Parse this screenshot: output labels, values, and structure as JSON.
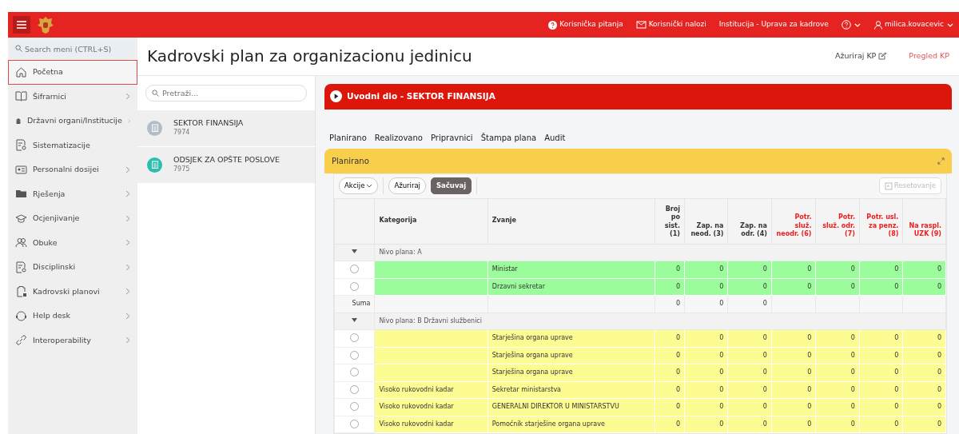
{
  "topbar": {
    "links": [
      {
        "kind": "question",
        "label": "Korisnička pitanja"
      },
      {
        "kind": "mail",
        "label": "Korisnički nalozi"
      },
      {
        "kind": "none",
        "label": "Institucija - Uprava za kadrove"
      }
    ],
    "user": "milica.kovacevic"
  },
  "sidebar": {
    "search_placeholder": "Search meni (CTRL+S)",
    "items": [
      {
        "label": "Početna",
        "selected": true,
        "has_children": false
      },
      {
        "label": "Šifrarnici",
        "selected": false,
        "has_children": true
      },
      {
        "label": "Državni organi/Institucije",
        "selected": false,
        "has_children": true
      },
      {
        "label": "Sistematizacije",
        "selected": false,
        "has_children": false
      },
      {
        "label": "Personalni dosijei",
        "selected": false,
        "has_children": true
      },
      {
        "label": "Rješenja",
        "selected": false,
        "has_children": true
      },
      {
        "label": "Ocjenjivanje",
        "selected": false,
        "has_children": true
      },
      {
        "label": "Obuke",
        "selected": false,
        "has_children": true
      },
      {
        "label": "Disciplinski",
        "selected": false,
        "has_children": true
      },
      {
        "label": "Kadrovski planovi",
        "selected": false,
        "has_children": true
      },
      {
        "label": "Help desk",
        "selected": false,
        "has_children": true
      },
      {
        "label": "Interoperability",
        "selected": false,
        "has_children": true
      }
    ]
  },
  "page": {
    "title": "Kadrovski plan za organizacionu jedinicu",
    "actions": [
      {
        "label": "Ažuriraj KP",
        "kind": "edit"
      },
      {
        "label": "Pregled KP",
        "kind": "link"
      }
    ]
  },
  "units": {
    "search_placeholder": "Pretraži...",
    "items": [
      {
        "name": "SEKTOR FINANSIJA",
        "code": "7974",
        "color": "#b4bcc6"
      },
      {
        "name": "ODSJEK ZA OPŠTE POSLOVE",
        "code": "7975",
        "color": "#2bbfb0"
      }
    ]
  },
  "section": {
    "title": "Uvodni dio - SEKTOR FINANSIJA"
  },
  "tabs": [
    {
      "label": "Planirano"
    },
    {
      "label": "Realizovano"
    },
    {
      "label": "Pripravnici"
    },
    {
      "label": "Štampa plana"
    },
    {
      "label": "Audit"
    }
  ],
  "panel": {
    "title": "Planirano",
    "toolbar": [
      {
        "label": "Akcije",
        "kind": "dropdown"
      },
      {
        "label": "Ažuriraj",
        "kind": "plain"
      },
      {
        "label": "Sačuvaj",
        "kind": "primary"
      }
    ],
    "reset": {
      "label": "Resetovanje",
      "disabled": true
    }
  },
  "table": {
    "columns": [
      {
        "label": "Kategorija",
        "highlight": false,
        "numeric": false
      },
      {
        "label": "Zvanje",
        "highlight": false,
        "numeric": false
      },
      {
        "label": "Broj po sist. (1)",
        "highlight": false,
        "numeric": true
      },
      {
        "label": "Zap. na neod. (3)",
        "highlight": false,
        "numeric": true
      },
      {
        "label": "Zap. na odr. (4)",
        "highlight": false,
        "numeric": true
      },
      {
        "label": "Potr. služ. neodr. (6)",
        "highlight": true,
        "numeric": true
      },
      {
        "label": "Potr. služ. odr. (7)",
        "highlight": true,
        "numeric": true
      },
      {
        "label": "Potr. usl. za penz. (8)",
        "highlight": true,
        "numeric": true
      },
      {
        "label": "Na raspl. UZK (9)",
        "highlight": true,
        "numeric": true
      }
    ],
    "groups": [
      {
        "label": "Nivo plana: A",
        "expanded": true,
        "rows": [
          {
            "selected": false,
            "color": "#9afc9a",
            "cells": [
              "",
              "Ministar",
              "0",
              "0",
              "0",
              "0",
              "0",
              "0",
              "0"
            ]
          },
          {
            "selected": false,
            "color": "#9afc9a",
            "cells": [
              "",
              "Drzavni sekretar",
              "0",
              "0",
              "0",
              "0",
              "0",
              "0",
              "0"
            ]
          }
        ],
        "sum": {
          "label": "Suma",
          "cells": [
            "0",
            "0",
            "0"
          ]
        }
      },
      {
        "label": "Nivo plana: B Državni službenici",
        "expanded": true,
        "rows": [
          {
            "selected": false,
            "color": "#fdfc93",
            "cells": [
              "",
              "Starješina organa uprave",
              "0",
              "0",
              "0",
              "0",
              "0",
              "0",
              "0"
            ]
          },
          {
            "selected": false,
            "color": "#fdfc93",
            "cells": [
              "",
              "Starješina organa uprave",
              "0",
              "0",
              "0",
              "0",
              "0",
              "0",
              "0"
            ]
          },
          {
            "selected": false,
            "color": "#fdfc93",
            "cells": [
              "",
              "Starješina organa uprave",
              "0",
              "0",
              "0",
              "0",
              "0",
              "0",
              "0"
            ]
          },
          {
            "selected": false,
            "color": "#fdfc93",
            "cells": [
              "Visoko rukovodni kadar",
              "Sekretar ministarstva",
              "0",
              "0",
              "0",
              "0",
              "0",
              "0",
              "0"
            ]
          },
          {
            "selected": false,
            "color": "#fdfc93",
            "cells": [
              "Visoko rukovodni kadar",
              "GENERALNI DIREKTOR U MINISTARSTVU",
              "0",
              "0",
              "0",
              "0",
              "0",
              "0",
              "0"
            ]
          },
          {
            "selected": false,
            "color": "#fdfc93",
            "cells": [
              "Visoko rukovodni kadar",
              "Pomoćnik starješine organa uprave",
              "0",
              "0",
              "0",
              "0",
              "0",
              "0",
              "0"
            ]
          }
        ]
      }
    ]
  }
}
